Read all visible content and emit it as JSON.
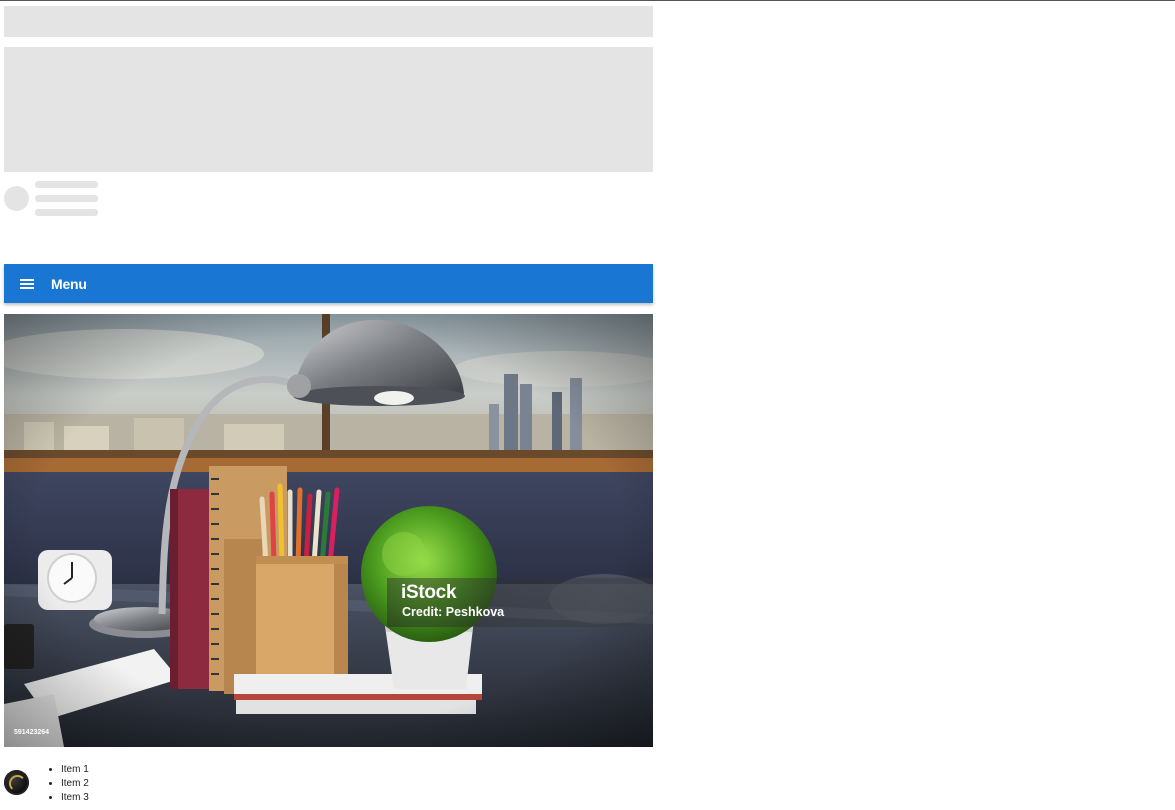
{
  "header": {
    "menu_label": "Menu",
    "menu_icon": "hamburger-icon",
    "accent_color": "#1976d2"
  },
  "photo": {
    "brand": "iStock",
    "credit": "Credit: Peshkova",
    "image_id": "591423264"
  },
  "list": {
    "icon": "logo-icon",
    "items": [
      "Item 1",
      "Item 2",
      "Item 3"
    ]
  }
}
